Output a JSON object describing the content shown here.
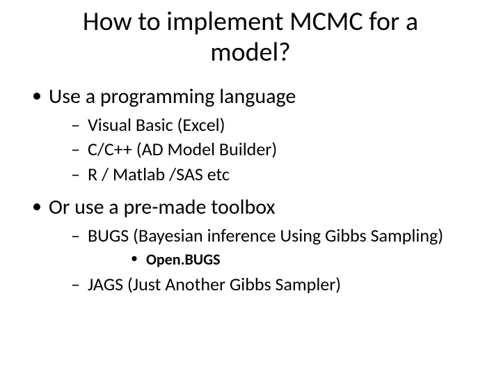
{
  "title": "How to implement MCMC for a model?",
  "bullets": {
    "top1": "Use a programming language",
    "sub1a": "Visual Basic (Excel)",
    "sub1b": "C/C++  (AD Model Builder)",
    "sub1c": "R / Matlab /SAS etc",
    "top2": "Or use a pre-made toolbox",
    "sub2a": "BUGS (Bayesian inference Using Gibbs Sampling)",
    "sub2a_i": "Open.BUGS",
    "sub2b": "JAGS (Just Another Gibbs Sampler)"
  }
}
